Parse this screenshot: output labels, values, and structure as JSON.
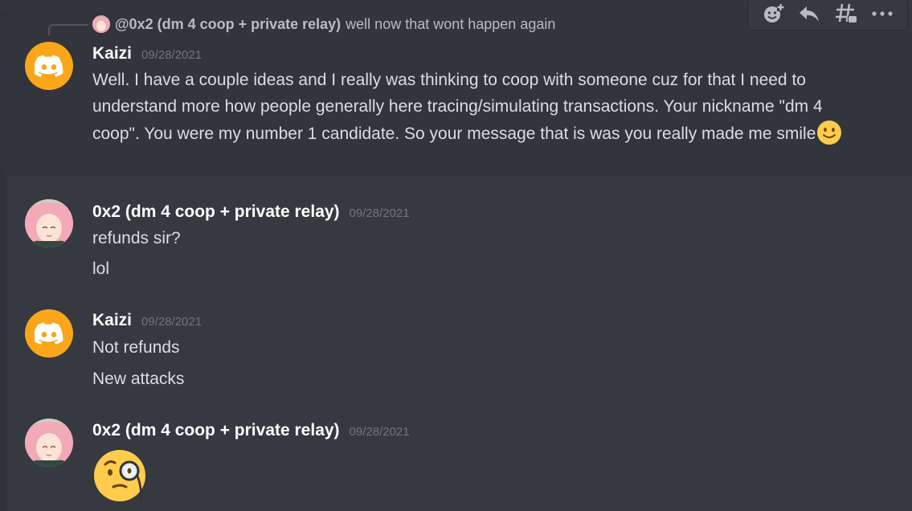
{
  "toolbar": {
    "buttons": [
      {
        "name": "add-reaction",
        "icon": "add-reaction-icon"
      },
      {
        "name": "reply",
        "icon": "reply-icon"
      },
      {
        "name": "create-thread",
        "icon": "thread-icon"
      },
      {
        "name": "more",
        "icon": "more-icon"
      }
    ]
  },
  "reply": {
    "author": "@0x2 (dm 4 coop + private relay)",
    "text": "well now that wont happen again"
  },
  "messages": [
    {
      "author": "Kaizi",
      "timestamp": "09/28/2021",
      "avatar_icon": "discord-logo-icon",
      "text": "Well. I have a couple ideas and I really was thinking to coop with someone cuz for that I need to understand more how people generally here tracing/simulating transactions. Your nickname \"dm 4 coop\". You were my number 1 candidate. So your message that is was you really made me smile",
      "trailing_emoji": "slightly-smiling-face-icon"
    },
    {
      "author": "0x2 (dm 4 coop + private relay)",
      "timestamp": "09/28/2021",
      "lines": [
        "refunds sir?",
        "lol"
      ]
    },
    {
      "author": "Kaizi",
      "timestamp": "09/28/2021",
      "avatar_icon": "discord-logo-icon",
      "lines": [
        "Not refunds",
        "New attacks"
      ]
    },
    {
      "author": "0x2 (dm 4 coop + private relay)",
      "timestamp": "09/28/2021",
      "emoji": "face-with-monocle-icon"
    }
  ],
  "colors": {
    "background": "#36393f",
    "hover_background": "#32353b",
    "discord_avatar": "#faa61a",
    "timestamp": "#72767d",
    "text": "#dcddde"
  }
}
